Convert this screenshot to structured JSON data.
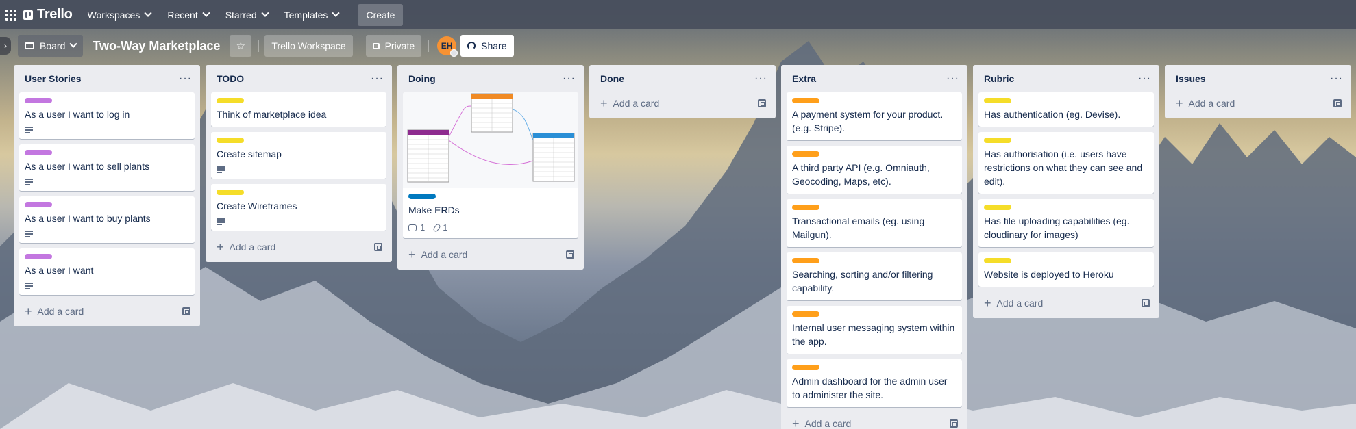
{
  "header": {
    "logo": "Trello",
    "nav": [
      "Workspaces",
      "Recent",
      "Starred",
      "Templates"
    ],
    "create": "Create"
  },
  "board": {
    "view": "Board",
    "title": "Two-Way Marketplace",
    "workspace": "Trello Workspace",
    "visibility": "Private",
    "avatar": "EH",
    "share": "Share"
  },
  "colors": {
    "purple": "#c377e0",
    "yellow": "#f5dd29",
    "orange": "#ff9f1a",
    "blue": "#0079bf"
  },
  "add_card": "Add a card",
  "lists": [
    {
      "title": "User Stories",
      "cards": [
        {
          "text": "As a user I want to log in"
        },
        {
          "text": "As a user I want to sell plants"
        },
        {
          "text": "As a user I want to buy plants"
        },
        {
          "text": "As a user I want"
        }
      ]
    },
    {
      "title": "TODO",
      "cards": [
        {
          "text": "Think of marketplace idea"
        },
        {
          "text": "Create sitemap"
        },
        {
          "text": "Create Wireframes"
        }
      ]
    },
    {
      "title": "Doing",
      "cards": [
        {
          "text": "Make ERDs",
          "comments": "1",
          "attachments": "1"
        }
      ]
    },
    {
      "title": "Done",
      "cards": []
    },
    {
      "title": "Extra",
      "cards": [
        {
          "text": "A payment system for your product. (e.g. Stripe)."
        },
        {
          "text": "A third party API (e.g. Omniauth, Geocoding, Maps, etc)."
        },
        {
          "text": "Transactional emails (eg. using Mailgun)."
        },
        {
          "text": "Searching, sorting and/or filtering capability."
        },
        {
          "text": "Internal user messaging system within the app."
        },
        {
          "text": "Admin dashboard for the admin user to administer the site."
        }
      ]
    },
    {
      "title": "Rubric",
      "cards": [
        {
          "text": "Has authentication (eg. Devise)."
        },
        {
          "text": "Has authorisation (i.e. users have restrictions on what they can see and edit)."
        },
        {
          "text": "Has file uploading capabilities (eg. cloudinary for images)"
        },
        {
          "text": "Website is deployed to Heroku"
        }
      ]
    },
    {
      "title": "Issues",
      "cards": []
    }
  ]
}
